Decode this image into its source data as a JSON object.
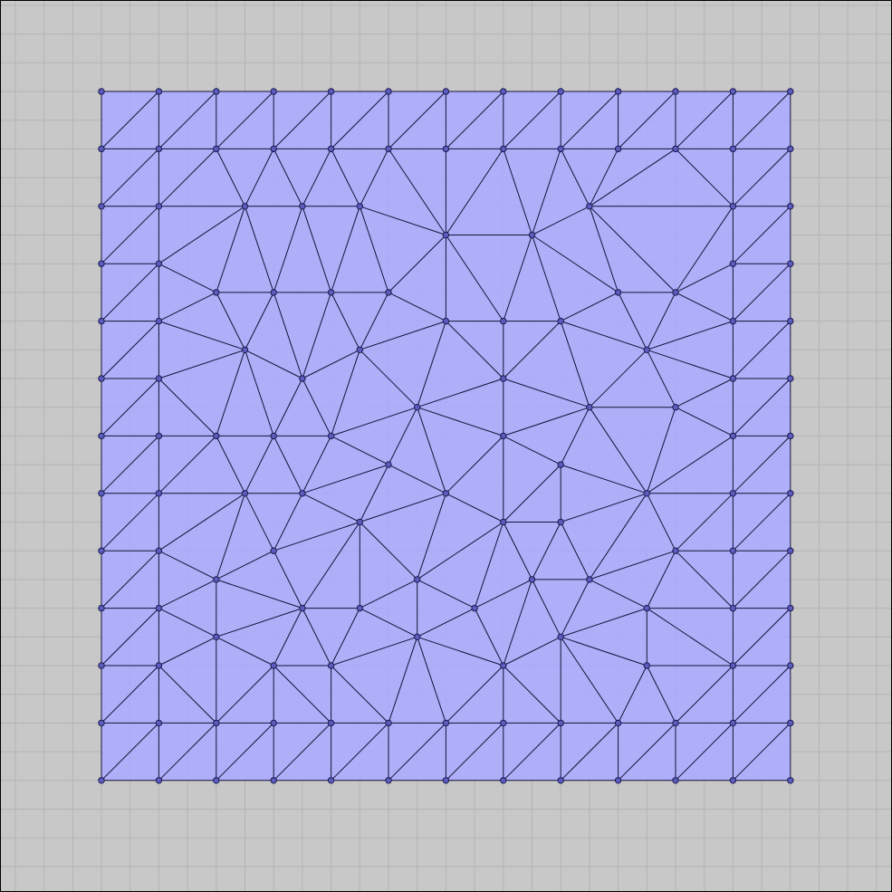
{
  "view": {
    "background_color": "#c8c8c8",
    "grid_color": "#b4b4b4",
    "border_color": "#000000"
  },
  "mesh": {
    "fill_color": "#aaaaff",
    "fill_opacity": 0.88,
    "edge_color": "#14143a",
    "vertex_fill": "#5c5cbf",
    "vertex_stroke": "#1a1a50",
    "grid_columns": 13,
    "grid_rows": 13,
    "interior_vertices": [
      [
        2.5,
        2
      ],
      [
        3.5,
        2
      ],
      [
        4.5,
        2
      ],
      [
        6,
        2.5
      ],
      [
        7.5,
        2.5
      ],
      [
        8.5,
        2
      ],
      [
        2,
        3.5
      ],
      [
        3,
        3.5
      ],
      [
        4,
        3.5
      ],
      [
        5,
        3.5
      ],
      [
        9,
        3.5
      ],
      [
        10,
        3.5
      ],
      [
        2.5,
        4.5
      ],
      [
        3.5,
        5
      ],
      [
        4.5,
        4.5
      ],
      [
        6,
        4
      ],
      [
        7,
        4
      ],
      [
        8,
        4
      ],
      [
        9.5,
        4.5
      ],
      [
        5.5,
        5.5
      ],
      [
        7,
        5
      ],
      [
        8.5,
        5.5
      ],
      [
        10,
        5.5
      ],
      [
        2,
        6
      ],
      [
        3,
        6
      ],
      [
        4,
        6
      ],
      [
        5,
        6.5
      ],
      [
        7,
        6
      ],
      [
        8,
        6.5
      ],
      [
        2.5,
        7
      ],
      [
        3.5,
        7
      ],
      [
        4.5,
        7.5
      ],
      [
        6,
        7
      ],
      [
        7,
        7.5
      ],
      [
        8,
        7.5
      ],
      [
        9.5,
        7
      ],
      [
        3,
        8
      ],
      [
        2,
        8.5
      ],
      [
        5.5,
        8.5
      ],
      [
        7.5,
        8.5
      ],
      [
        8.5,
        8.5
      ],
      [
        10,
        8
      ],
      [
        3.5,
        9
      ],
      [
        4.5,
        9
      ],
      [
        6.5,
        9
      ],
      [
        9.5,
        9
      ],
      [
        2,
        9.5
      ],
      [
        3,
        10
      ],
      [
        4,
        10
      ],
      [
        5.5,
        9.5
      ],
      [
        7,
        10
      ],
      [
        8,
        9.5
      ],
      [
        9.5,
        10
      ]
    ]
  }
}
